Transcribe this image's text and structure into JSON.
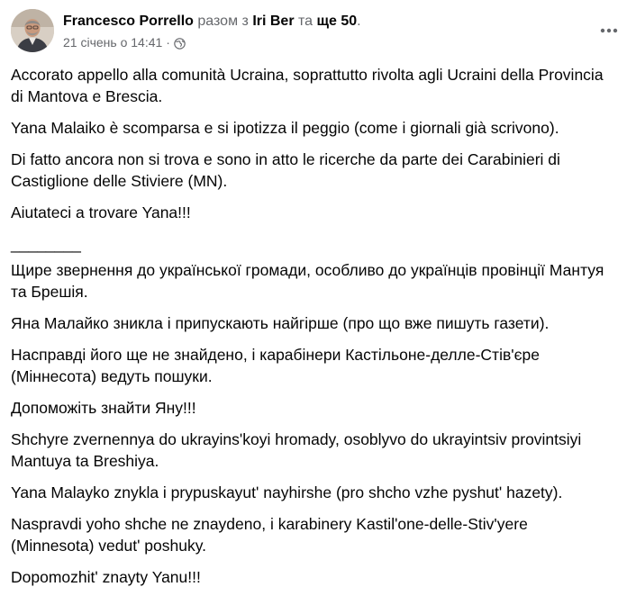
{
  "post": {
    "author": "Francesco Porrello",
    "with_word": "разом з",
    "tagged": "Iri Ber",
    "and_word": "та",
    "others": "ще 50",
    "period": ".",
    "date": "21 січень о 14:41",
    "dot": "·",
    "privacy_icon": "globe-icon",
    "more_icon": "more-dots-icon",
    "paragraphs": [
      "Accorato appello alla comunità Ucraina, soprattutto rivolta agli Ucraini della Provincia di Mantova e Brescia.",
      "Yana Malaiko è scomparsa e si ipotizza il peggio (come i giornali già scrivono).",
      "Di fatto ancora non si trova e sono in atto le ricerche da parte dei Carabinieri di Castiglione delle Stiviere (MN).",
      "Aiutateci a trovare Yana!!!",
      "________",
      "Щире звернення до української громади, особливо до українців провінції Мантуя та Брешія.",
      "Яна Малайко зникла і припускають найгірше (про що вже пишуть газети).",
      "Насправді його ще не знайдено, і карабінери Кастільоне-делле-Стів'єре (Міннесота) ведуть пошуки.",
      "Допоможіть знайти Яну!!!",
      "Shchyre zvernennya do ukrayinsʹkoyi hromady, osoblyvo do ukrayintsiv provintsiyi Mantuya ta Breshiya.",
      "Yana Malayko znykla i prypuskayutʹ nayhirshe (pro shcho vzhe pyshutʹ hazety).",
      "Naspravdi yoho shche ne znaydeno, i karabinery Kastilʹone-delle-Stiv'yere (Minnesota) vedutʹ poshuky.",
      "Dopomozhitʹ znayty Yanu!!!"
    ]
  }
}
